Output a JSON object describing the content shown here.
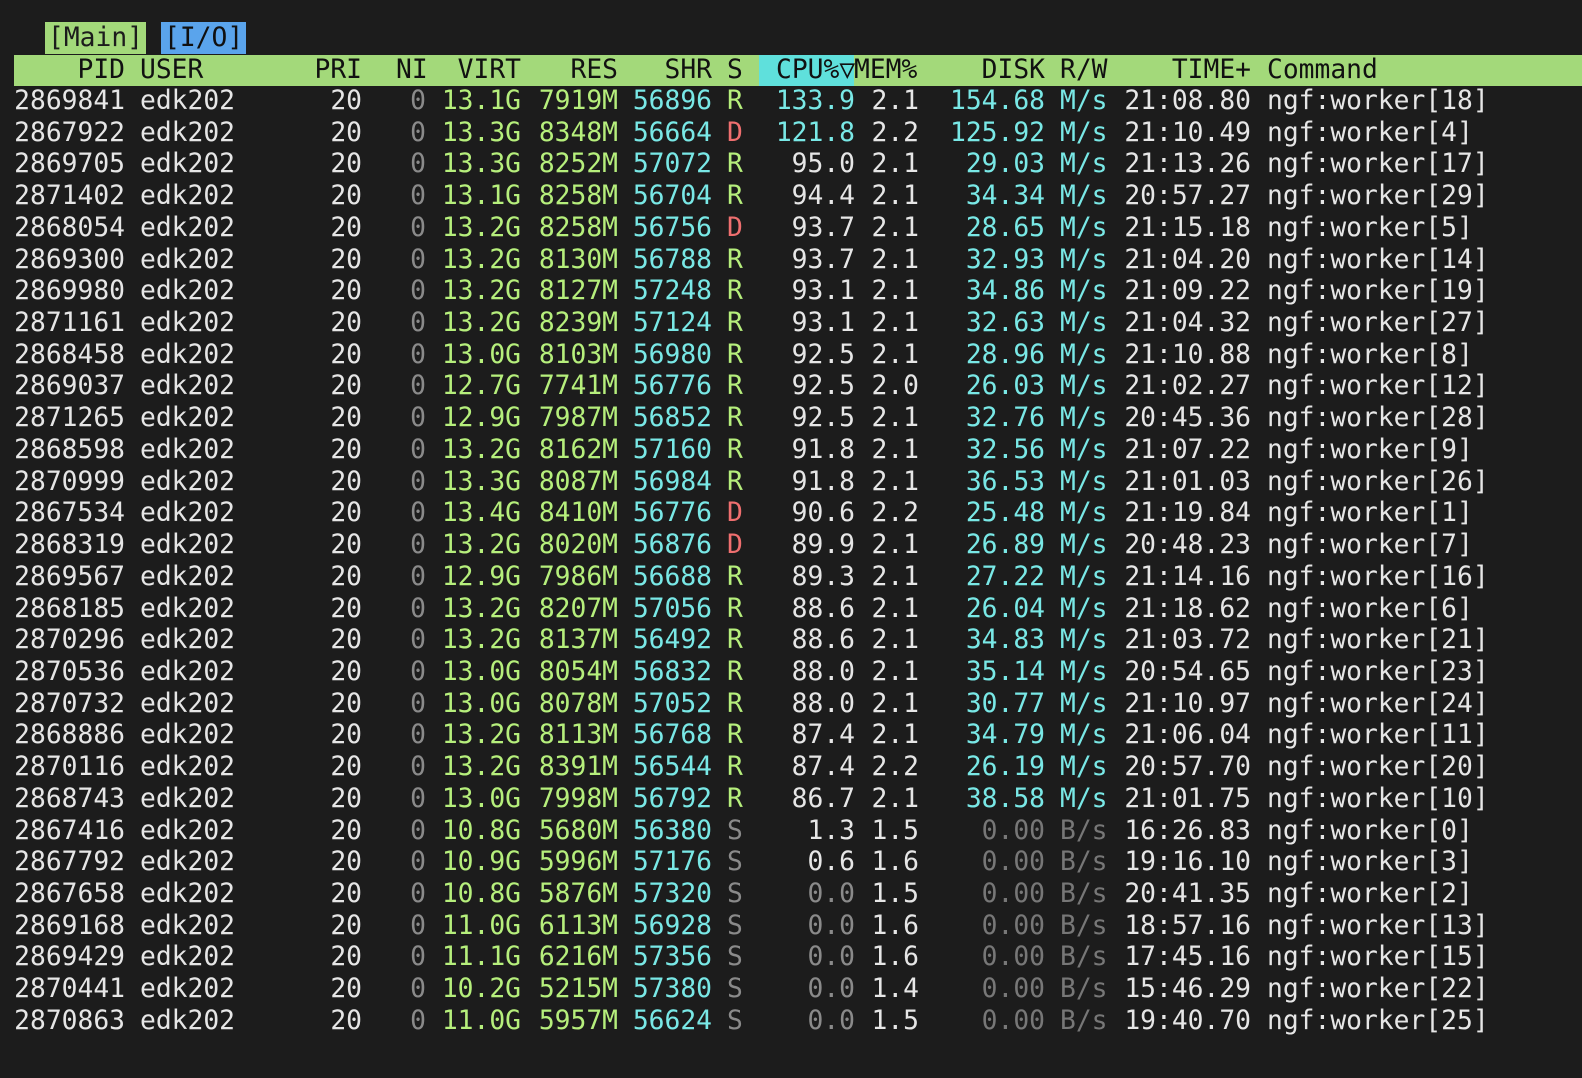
{
  "tabs": [
    "[Main]",
    "[I/O]"
  ],
  "header": {
    "pid": "PID",
    "user": "USER",
    "pri": "PRI",
    "ni": "NI",
    "virt": "VIRT",
    "res": "RES",
    "shr": "SHR",
    "s": "S",
    "cpu": "CPU%▽",
    "mem": "MEM%",
    "disk": "DISK",
    "rw": "R/W",
    "time": "TIME+",
    "command": "Command"
  },
  "colors": {
    "background": "#1c1c1c",
    "header_bar": "#a3d97a",
    "tab_main": "#a3d97a",
    "tab_io": "#5aa4ec",
    "sorted_column": "#5fe0dc",
    "state_running": "#b6ef7c",
    "state_disk_wait": "#ef6f6f",
    "state_sleeping": "#8a8a8a",
    "highlight_cyan": "#79e8e6"
  },
  "processes": [
    {
      "pid": "2869841",
      "user": "edk202",
      "pri": "20",
      "ni": "0",
      "virt": "13.1G",
      "res": "7919M",
      "shr": "56896",
      "s": "R",
      "cpu": "133.9",
      "mem": "2.1",
      "disk": "154.68",
      "rw": "M/s",
      "time": "21:08.80",
      "cmd": "ngf:worker[18]"
    },
    {
      "pid": "2867922",
      "user": "edk202",
      "pri": "20",
      "ni": "0",
      "virt": "13.3G",
      "res": "8348M",
      "shr": "56664",
      "s": "D",
      "cpu": "121.8",
      "mem": "2.2",
      "disk": "125.92",
      "rw": "M/s",
      "time": "21:10.49",
      "cmd": "ngf:worker[4]"
    },
    {
      "pid": "2869705",
      "user": "edk202",
      "pri": "20",
      "ni": "0",
      "virt": "13.3G",
      "res": "8252M",
      "shr": "57072",
      "s": "R",
      "cpu": "95.0",
      "mem": "2.1",
      "disk": "29.03",
      "rw": "M/s",
      "time": "21:13.26",
      "cmd": "ngf:worker[17]"
    },
    {
      "pid": "2871402",
      "user": "edk202",
      "pri": "20",
      "ni": "0",
      "virt": "13.1G",
      "res": "8258M",
      "shr": "56704",
      "s": "R",
      "cpu": "94.4",
      "mem": "2.1",
      "disk": "34.34",
      "rw": "M/s",
      "time": "20:57.27",
      "cmd": "ngf:worker[29]"
    },
    {
      "pid": "2868054",
      "user": "edk202",
      "pri": "20",
      "ni": "0",
      "virt": "13.2G",
      "res": "8258M",
      "shr": "56756",
      "s": "D",
      "cpu": "93.7",
      "mem": "2.1",
      "disk": "28.65",
      "rw": "M/s",
      "time": "21:15.18",
      "cmd": "ngf:worker[5]"
    },
    {
      "pid": "2869300",
      "user": "edk202",
      "pri": "20",
      "ni": "0",
      "virt": "13.2G",
      "res": "8130M",
      "shr": "56788",
      "s": "R",
      "cpu": "93.7",
      "mem": "2.1",
      "disk": "32.93",
      "rw": "M/s",
      "time": "21:04.20",
      "cmd": "ngf:worker[14]"
    },
    {
      "pid": "2869980",
      "user": "edk202",
      "pri": "20",
      "ni": "0",
      "virt": "13.2G",
      "res": "8127M",
      "shr": "57248",
      "s": "R",
      "cpu": "93.1",
      "mem": "2.1",
      "disk": "34.86",
      "rw": "M/s",
      "time": "21:09.22",
      "cmd": "ngf:worker[19]"
    },
    {
      "pid": "2871161",
      "user": "edk202",
      "pri": "20",
      "ni": "0",
      "virt": "13.2G",
      "res": "8239M",
      "shr": "57124",
      "s": "R",
      "cpu": "93.1",
      "mem": "2.1",
      "disk": "32.63",
      "rw": "M/s",
      "time": "21:04.32",
      "cmd": "ngf:worker[27]"
    },
    {
      "pid": "2868458",
      "user": "edk202",
      "pri": "20",
      "ni": "0",
      "virt": "13.0G",
      "res": "8103M",
      "shr": "56980",
      "s": "R",
      "cpu": "92.5",
      "mem": "2.1",
      "disk": "28.96",
      "rw": "M/s",
      "time": "21:10.88",
      "cmd": "ngf:worker[8]"
    },
    {
      "pid": "2869037",
      "user": "edk202",
      "pri": "20",
      "ni": "0",
      "virt": "12.7G",
      "res": "7741M",
      "shr": "56776",
      "s": "R",
      "cpu": "92.5",
      "mem": "2.0",
      "disk": "26.03",
      "rw": "M/s",
      "time": "21:02.27",
      "cmd": "ngf:worker[12]"
    },
    {
      "pid": "2871265",
      "user": "edk202",
      "pri": "20",
      "ni": "0",
      "virt": "12.9G",
      "res": "7987M",
      "shr": "56852",
      "s": "R",
      "cpu": "92.5",
      "mem": "2.1",
      "disk": "32.76",
      "rw": "M/s",
      "time": "20:45.36",
      "cmd": "ngf:worker[28]"
    },
    {
      "pid": "2868598",
      "user": "edk202",
      "pri": "20",
      "ni": "0",
      "virt": "13.2G",
      "res": "8162M",
      "shr": "57160",
      "s": "R",
      "cpu": "91.8",
      "mem": "2.1",
      "disk": "32.56",
      "rw": "M/s",
      "time": "21:07.22",
      "cmd": "ngf:worker[9]"
    },
    {
      "pid": "2870999",
      "user": "edk202",
      "pri": "20",
      "ni": "0",
      "virt": "13.3G",
      "res": "8087M",
      "shr": "56984",
      "s": "R",
      "cpu": "91.8",
      "mem": "2.1",
      "disk": "36.53",
      "rw": "M/s",
      "time": "21:01.03",
      "cmd": "ngf:worker[26]"
    },
    {
      "pid": "2867534",
      "user": "edk202",
      "pri": "20",
      "ni": "0",
      "virt": "13.4G",
      "res": "8410M",
      "shr": "56776",
      "s": "D",
      "cpu": "90.6",
      "mem": "2.2",
      "disk": "25.48",
      "rw": "M/s",
      "time": "21:19.84",
      "cmd": "ngf:worker[1]"
    },
    {
      "pid": "2868319",
      "user": "edk202",
      "pri": "20",
      "ni": "0",
      "virt": "13.2G",
      "res": "8020M",
      "shr": "56876",
      "s": "D",
      "cpu": "89.9",
      "mem": "2.1",
      "disk": "26.89",
      "rw": "M/s",
      "time": "20:48.23",
      "cmd": "ngf:worker[7]"
    },
    {
      "pid": "2869567",
      "user": "edk202",
      "pri": "20",
      "ni": "0",
      "virt": "12.9G",
      "res": "7986M",
      "shr": "56688",
      "s": "R",
      "cpu": "89.3",
      "mem": "2.1",
      "disk": "27.22",
      "rw": "M/s",
      "time": "21:14.16",
      "cmd": "ngf:worker[16]"
    },
    {
      "pid": "2868185",
      "user": "edk202",
      "pri": "20",
      "ni": "0",
      "virt": "13.2G",
      "res": "8207M",
      "shr": "57056",
      "s": "R",
      "cpu": "88.6",
      "mem": "2.1",
      "disk": "26.04",
      "rw": "M/s",
      "time": "21:18.62",
      "cmd": "ngf:worker[6]"
    },
    {
      "pid": "2870296",
      "user": "edk202",
      "pri": "20",
      "ni": "0",
      "virt": "13.2G",
      "res": "8137M",
      "shr": "56492",
      "s": "R",
      "cpu": "88.6",
      "mem": "2.1",
      "disk": "34.83",
      "rw": "M/s",
      "time": "21:03.72",
      "cmd": "ngf:worker[21]"
    },
    {
      "pid": "2870536",
      "user": "edk202",
      "pri": "20",
      "ni": "0",
      "virt": "13.0G",
      "res": "8054M",
      "shr": "56832",
      "s": "R",
      "cpu": "88.0",
      "mem": "2.1",
      "disk": "35.14",
      "rw": "M/s",
      "time": "20:54.65",
      "cmd": "ngf:worker[23]"
    },
    {
      "pid": "2870732",
      "user": "edk202",
      "pri": "20",
      "ni": "0",
      "virt": "13.0G",
      "res": "8078M",
      "shr": "57052",
      "s": "R",
      "cpu": "88.0",
      "mem": "2.1",
      "disk": "30.77",
      "rw": "M/s",
      "time": "21:10.97",
      "cmd": "ngf:worker[24]"
    },
    {
      "pid": "2868886",
      "user": "edk202",
      "pri": "20",
      "ni": "0",
      "virt": "13.2G",
      "res": "8113M",
      "shr": "56768",
      "s": "R",
      "cpu": "87.4",
      "mem": "2.1",
      "disk": "34.79",
      "rw": "M/s",
      "time": "21:06.04",
      "cmd": "ngf:worker[11]"
    },
    {
      "pid": "2870116",
      "user": "edk202",
      "pri": "20",
      "ni": "0",
      "virt": "13.2G",
      "res": "8391M",
      "shr": "56544",
      "s": "R",
      "cpu": "87.4",
      "mem": "2.2",
      "disk": "26.19",
      "rw": "M/s",
      "time": "20:57.70",
      "cmd": "ngf:worker[20]"
    },
    {
      "pid": "2868743",
      "user": "edk202",
      "pri": "20",
      "ni": "0",
      "virt": "13.0G",
      "res": "7998M",
      "shr": "56792",
      "s": "R",
      "cpu": "86.7",
      "mem": "2.1",
      "disk": "38.58",
      "rw": "M/s",
      "time": "21:01.75",
      "cmd": "ngf:worker[10]"
    },
    {
      "pid": "2867416",
      "user": "edk202",
      "pri": "20",
      "ni": "0",
      "virt": "10.8G",
      "res": "5680M",
      "shr": "56380",
      "s": "S",
      "cpu": "1.3",
      "mem": "1.5",
      "disk": "0.00",
      "rw": "B/s",
      "time": "16:26.83",
      "cmd": "ngf:worker[0]"
    },
    {
      "pid": "2867792",
      "user": "edk202",
      "pri": "20",
      "ni": "0",
      "virt": "10.9G",
      "res": "5996M",
      "shr": "57176",
      "s": "S",
      "cpu": "0.6",
      "mem": "1.6",
      "disk": "0.00",
      "rw": "B/s",
      "time": "19:16.10",
      "cmd": "ngf:worker[3]"
    },
    {
      "pid": "2867658",
      "user": "edk202",
      "pri": "20",
      "ni": "0",
      "virt": "10.8G",
      "res": "5876M",
      "shr": "57320",
      "s": "S",
      "cpu": "0.0",
      "mem": "1.5",
      "disk": "0.00",
      "rw": "B/s",
      "time": "20:41.35",
      "cmd": "ngf:worker[2]"
    },
    {
      "pid": "2869168",
      "user": "edk202",
      "pri": "20",
      "ni": "0",
      "virt": "11.0G",
      "res": "6113M",
      "shr": "56928",
      "s": "S",
      "cpu": "0.0",
      "mem": "1.6",
      "disk": "0.00",
      "rw": "B/s",
      "time": "18:57.16",
      "cmd": "ngf:worker[13]"
    },
    {
      "pid": "2869429",
      "user": "edk202",
      "pri": "20",
      "ni": "0",
      "virt": "11.1G",
      "res": "6216M",
      "shr": "57356",
      "s": "S",
      "cpu": "0.0",
      "mem": "1.6",
      "disk": "0.00",
      "rw": "B/s",
      "time": "17:45.16",
      "cmd": "ngf:worker[15]"
    },
    {
      "pid": "2870441",
      "user": "edk202",
      "pri": "20",
      "ni": "0",
      "virt": "10.2G",
      "res": "5215M",
      "shr": "57380",
      "s": "S",
      "cpu": "0.0",
      "mem": "1.4",
      "disk": "0.00",
      "rw": "B/s",
      "time": "15:46.29",
      "cmd": "ngf:worker[22]"
    },
    {
      "pid": "2870863",
      "user": "edk202",
      "pri": "20",
      "ni": "0",
      "virt": "11.0G",
      "res": "5957M",
      "shr": "56624",
      "s": "S",
      "cpu": "0.0",
      "mem": "1.5",
      "disk": "0.00",
      "rw": "B/s",
      "time": "19:40.70",
      "cmd": "ngf:worker[25]"
    }
  ]
}
